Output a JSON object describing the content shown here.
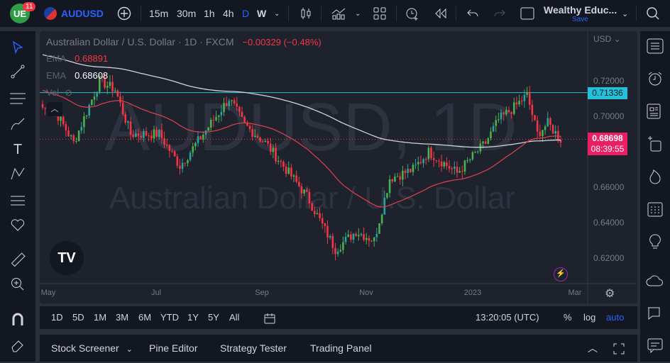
{
  "topbar": {
    "notifications": "11",
    "symbol": "AUDUSD",
    "intervals": [
      "15m",
      "30m",
      "1h",
      "4h",
      "D",
      "W"
    ],
    "active_interval": "D",
    "layout_name": "Wealthy Educ...",
    "save_label": "Save"
  },
  "legend": {
    "title": "Australian Dollar / U.S. Dollar · 1D · FXCM",
    "change": "−0.00329 (−0.48%)",
    "ema1_label": "EMA",
    "ema1_value": "0.68891",
    "ema2_label": "EMA",
    "ema2_value": "0.68608",
    "vol_label": "Vol"
  },
  "watermark": {
    "line1": "AUDUSD, 1D",
    "line2": "Australian Dollar / U.S. Dollar"
  },
  "price_axis": {
    "currency": "USD",
    "ticks": [
      "0.72000",
      "0.70000",
      "0.66000",
      "0.64000",
      "0.62000"
    ],
    "line_label": "0.71336",
    "last_price": "0.68698",
    "countdown": "08:39:55"
  },
  "time_axis": {
    "ticks": [
      "May",
      "Jul",
      "Sep",
      "Nov",
      "2023",
      "Mar"
    ]
  },
  "colors": {
    "up": "#26a69a",
    "up_alt": "#4caf50",
    "down": "#f23645",
    "ema_fast": "#e0424f",
    "ema_slow": "#d1d4dc",
    "hline": "#22c1d9",
    "accent": "#2962ff",
    "last": "#e91e63"
  },
  "chart_data": {
    "type": "candlestick",
    "symbol": "AUDUSD",
    "timeframe": "1D",
    "ylim": [
      0.61,
      0.735
    ],
    "hline": 0.71336,
    "waypoints": [
      [
        0,
        0.705
      ],
      [
        6,
        0.7
      ],
      [
        12,
        0.685
      ],
      [
        22,
        0.72
      ],
      [
        28,
        0.715
      ],
      [
        34,
        0.69
      ],
      [
        45,
        0.69
      ],
      [
        53,
        0.672
      ],
      [
        62,
        0.69
      ],
      [
        72,
        0.71
      ],
      [
        78,
        0.695
      ],
      [
        86,
        0.685
      ],
      [
        94,
        0.67
      ],
      [
        102,
        0.655
      ],
      [
        113,
        0.625
      ],
      [
        121,
        0.635
      ],
      [
        128,
        0.63
      ],
      [
        134,
        0.665
      ],
      [
        143,
        0.67
      ],
      [
        149,
        0.68
      ],
      [
        160,
        0.668
      ],
      [
        171,
        0.685
      ],
      [
        176,
        0.698
      ],
      [
        182,
        0.705
      ],
      [
        187,
        0.712
      ],
      [
        191,
        0.69
      ],
      [
        195,
        0.696
      ],
      [
        200,
        0.687
      ]
    ]
  },
  "range_bar": {
    "ranges": [
      "1D",
      "5D",
      "1M",
      "3M",
      "6M",
      "YTD",
      "1Y",
      "5Y",
      "All"
    ],
    "clock": "13:20:05 (UTC)",
    "percent": "%",
    "log": "log",
    "auto": "auto"
  },
  "bottom_panel": {
    "tabs": [
      "Stock Screener",
      "Pine Editor",
      "Strategy Tester",
      "Trading Panel"
    ]
  }
}
